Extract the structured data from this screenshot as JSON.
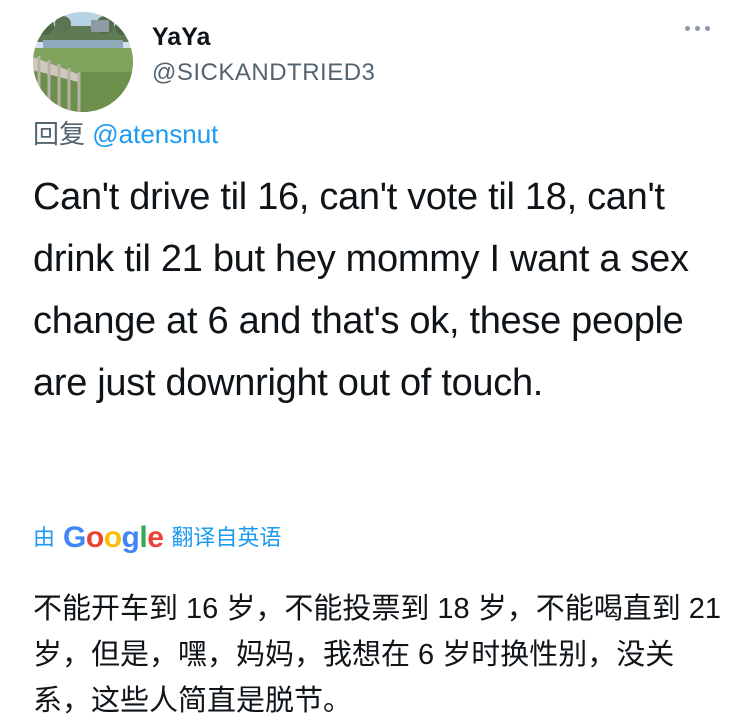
{
  "user": {
    "display_name": "YaYa",
    "handle": "@SICKANDTRIED3"
  },
  "reply": {
    "prefix": "回复",
    "mention": "@atensnut"
  },
  "tweet": {
    "text": "Can't drive til 16,  can't vote til 18, can't drink til 21 but hey mommy I want a sex change at 6 and that's ok, these people are just downright out of touch."
  },
  "translation": {
    "by_label": "由",
    "google_letters": [
      "G",
      "o",
      "o",
      "g",
      "l",
      "e"
    ],
    "action_label": "翻译自英语",
    "text": "不能开车到 16 岁，不能投票到 18 岁，不能喝直到 21 岁，但是，嘿，妈妈，我想在 6 岁时换性别，没关系，这些人简直是脱节。"
  },
  "icons": {
    "more": "more-horizontal-icon"
  },
  "colors": {
    "link": "#1d9bf0",
    "secondary_text": "#536471",
    "primary_text": "#0f1419"
  }
}
